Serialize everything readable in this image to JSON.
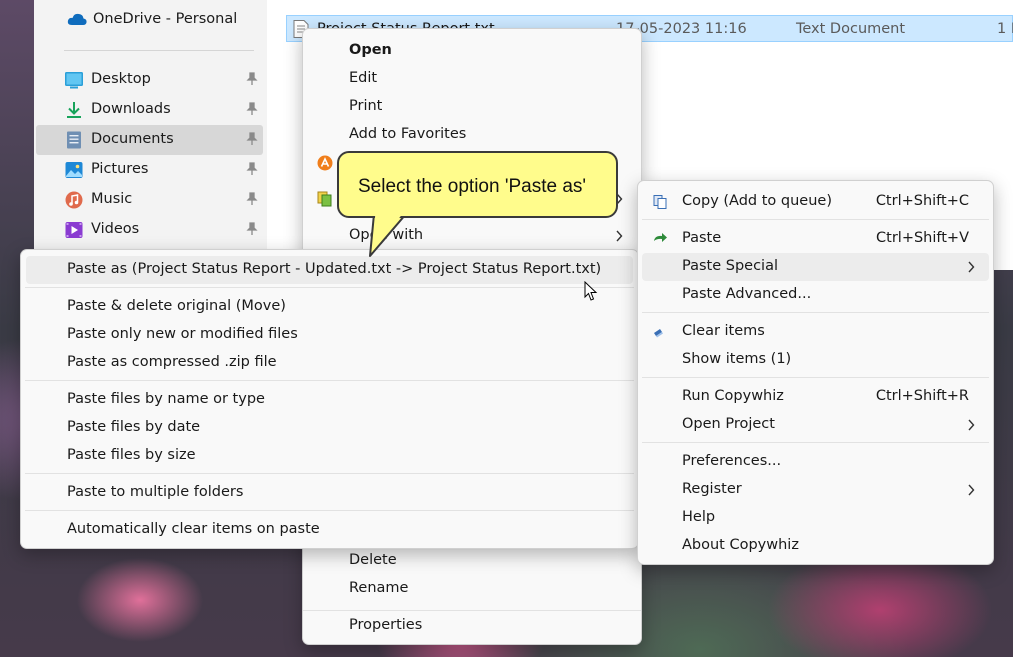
{
  "nav": {
    "onedrive": "OneDrive - Personal",
    "items": [
      {
        "label": "Desktop",
        "icon": "desktop-icon"
      },
      {
        "label": "Downloads",
        "icon": "downloads-icon"
      },
      {
        "label": "Documents",
        "icon": "documents-icon",
        "selected": true
      },
      {
        "label": "Pictures",
        "icon": "pictures-icon"
      },
      {
        "label": "Music",
        "icon": "music-icon"
      },
      {
        "label": "Videos",
        "icon": "videos-icon"
      }
    ]
  },
  "file": {
    "name": "Project Status Report.txt",
    "date": "17-05-2023 11:16",
    "type": "Text Document",
    "size": "1 I"
  },
  "main_menu": {
    "open": "Open",
    "edit": "Edit",
    "print": "Print",
    "add_favorites": "Add to Favorites",
    "open_with": "Open with",
    "delete": "Delete",
    "rename": "Rename",
    "properties": "Properties"
  },
  "callout": {
    "text": "Select the option 'Paste as'"
  },
  "paste_as_menu": {
    "paste_as": "Paste as (Project Status Report - Updated.txt -> Project Status Report.txt)",
    "paste_delete": "Paste & delete original (Move)",
    "paste_new": "Paste only new or modified files",
    "paste_zip": "Paste as compressed .zip file",
    "paste_by_name": "Paste files by name or type",
    "paste_by_date": "Paste files by date",
    "paste_by_size": "Paste files by size",
    "paste_multiple": "Paste to multiple folders",
    "auto_clear": "Automatically clear items on paste"
  },
  "copywhiz_menu": {
    "copy": "Copy (Add to queue)",
    "copy_sc": "Ctrl+Shift+C",
    "paste": "Paste",
    "paste_sc": "Ctrl+Shift+V",
    "paste_special": "Paste Special",
    "paste_advanced": "Paste Advanced...",
    "clear_items": "Clear items",
    "show_items": "Show items (1)",
    "run": "Run Copywhiz",
    "run_sc": "Ctrl+Shift+R",
    "open_project": "Open Project",
    "preferences": "Preferences...",
    "register": "Register",
    "help": "Help",
    "about": "About Copywhiz"
  },
  "colors": {
    "selection": "#cce8ff",
    "callout": "#fffc8c",
    "menu_bg": "#f9f9f9"
  }
}
